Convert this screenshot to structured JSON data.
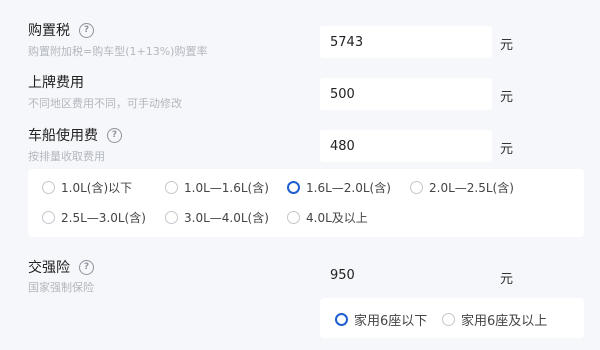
{
  "purchase_tax": {
    "label": "购置税",
    "hint": "购置附加税=购车型(1+13%)购置率",
    "value": "5743",
    "unit": "元"
  },
  "plate_fee": {
    "label": "上牌费用",
    "hint": "不同地区费用不同，可手动修改",
    "value": "500",
    "unit": "元"
  },
  "vessel_tax": {
    "label": "车船使用费",
    "hint": "按排量收取费用",
    "value": "480",
    "unit": "元",
    "options": [
      {
        "label": "1.0L(含)以下",
        "selected": false
      },
      {
        "label": "1.0L—1.6L(含)",
        "selected": false
      },
      {
        "label": "1.6L—2.0L(含)",
        "selected": true
      },
      {
        "label": "2.0L—2.5L(含)",
        "selected": false
      },
      {
        "label": "2.5L—3.0L(含)",
        "selected": false
      },
      {
        "label": "3.0L—4.0L(含)",
        "selected": false
      },
      {
        "label": "4.0L及以上",
        "selected": false
      }
    ]
  },
  "compulsory_insurance": {
    "label": "交强险",
    "hint": "国家强制保险",
    "value": "950",
    "unit": "元",
    "options": [
      {
        "label": "家用6座以下",
        "selected": true
      },
      {
        "label": "家用6座及以上",
        "selected": false
      }
    ]
  },
  "help_glyph": "?",
  "accent_color": "#1f5fd1"
}
